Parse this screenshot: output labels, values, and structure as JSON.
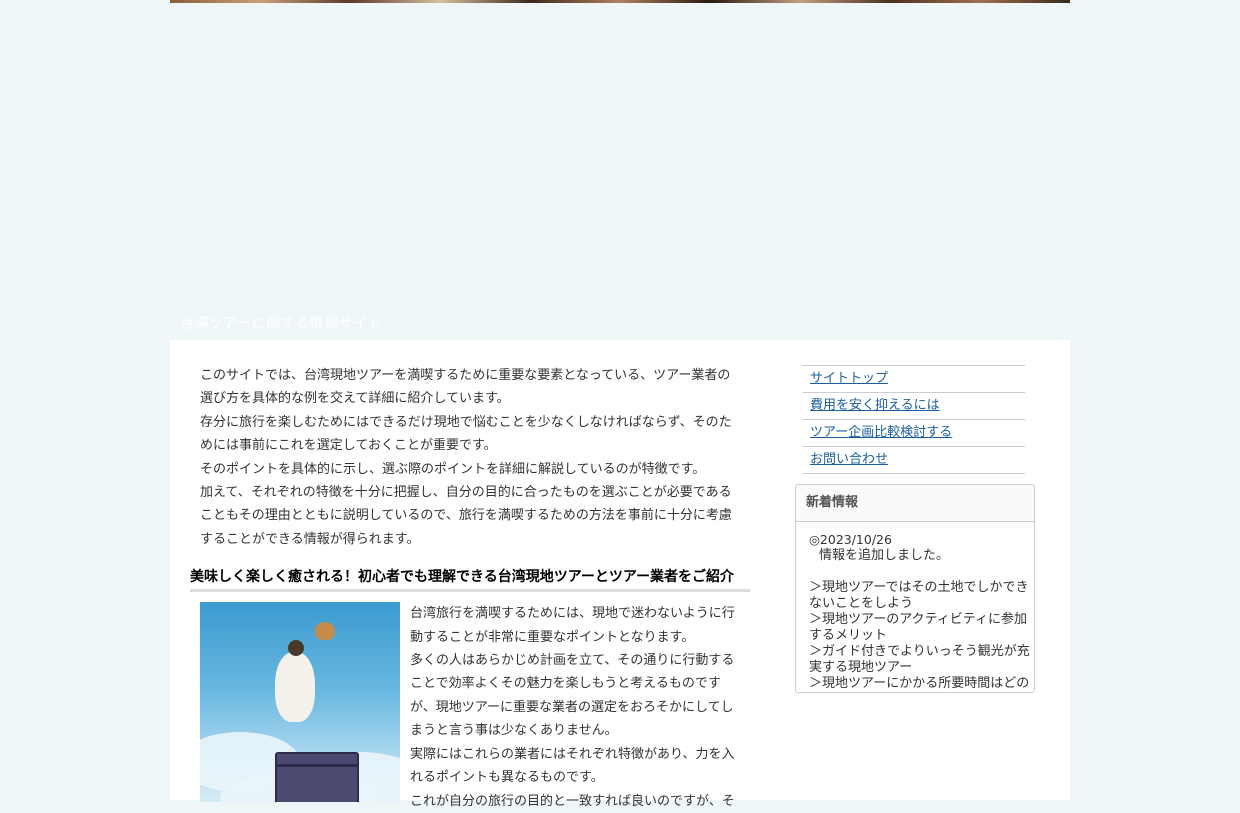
{
  "site": {
    "tagline": "台湾ツアーに関する情報サイト"
  },
  "intro": {
    "paragraphs": [
      "このサイトでは、台湾現地ツアーを満喫するために重要な要素となっている、ツアー業者の選び方を具体的な例を交えて詳細に紹介しています。",
      "存分に旅行を楽しむためにはできるだけ現地で悩むことを少なくしなければならず、そのためには事前にこれを選定しておくことが重要です。",
      "そのポイントを具体的に示し、選ぶ際のポイントを詳細に解説しているのが特徴です。",
      "加えて、それぞれの特徴を十分に把握し、自分の目的に合ったものを選ぶことが必要であることもその理由とともに説明しているので、旅行を満喫するための方法を事前に十分に考慮することができる情報が得られます。"
    ]
  },
  "article": {
    "heading": "美味しく楽しく癒される！初心者でも理解できる台湾現地ツアーとツアー業者をご紹介",
    "paragraphs": [
      "台湾旅行を満喫するためには、現地で迷わないように行動することが非常に重要なポイントとなります。",
      "多くの人はあらかじめ計画を立て、その通りに行動することで効率よくその魅力を楽しもうと考えるものですが、現地ツアーに重要な業者の選定をおろそかにしてしまうと言う事は少なくありません。",
      "実際にはこれらの業者にはそれぞれ特徴があり、力を入れるポイントも異なるものです。",
      "これが自分の旅行の目的と一致すれば良いのですが、そ"
    ]
  },
  "sidebar": {
    "nav": [
      {
        "label": "サイトトップ"
      },
      {
        "label": "費用を安く抑えるには"
      },
      {
        "label": "ツアー企画比較検討する"
      },
      {
        "label": "お問い合わせ"
      }
    ],
    "news": {
      "title": "新着情報",
      "date": "◎2023/10/26",
      "added": "情報を追加しました。",
      "items": [
        "＞現地ツアーではその土地でしかできないことをしよう",
        "＞現地ツアーのアクティビティに参加するメリット",
        "＞ガイド付きでよりいっそう観光が充実する現地ツアー",
        "＞現地ツアーにかかる所要時間はどの"
      ]
    }
  }
}
